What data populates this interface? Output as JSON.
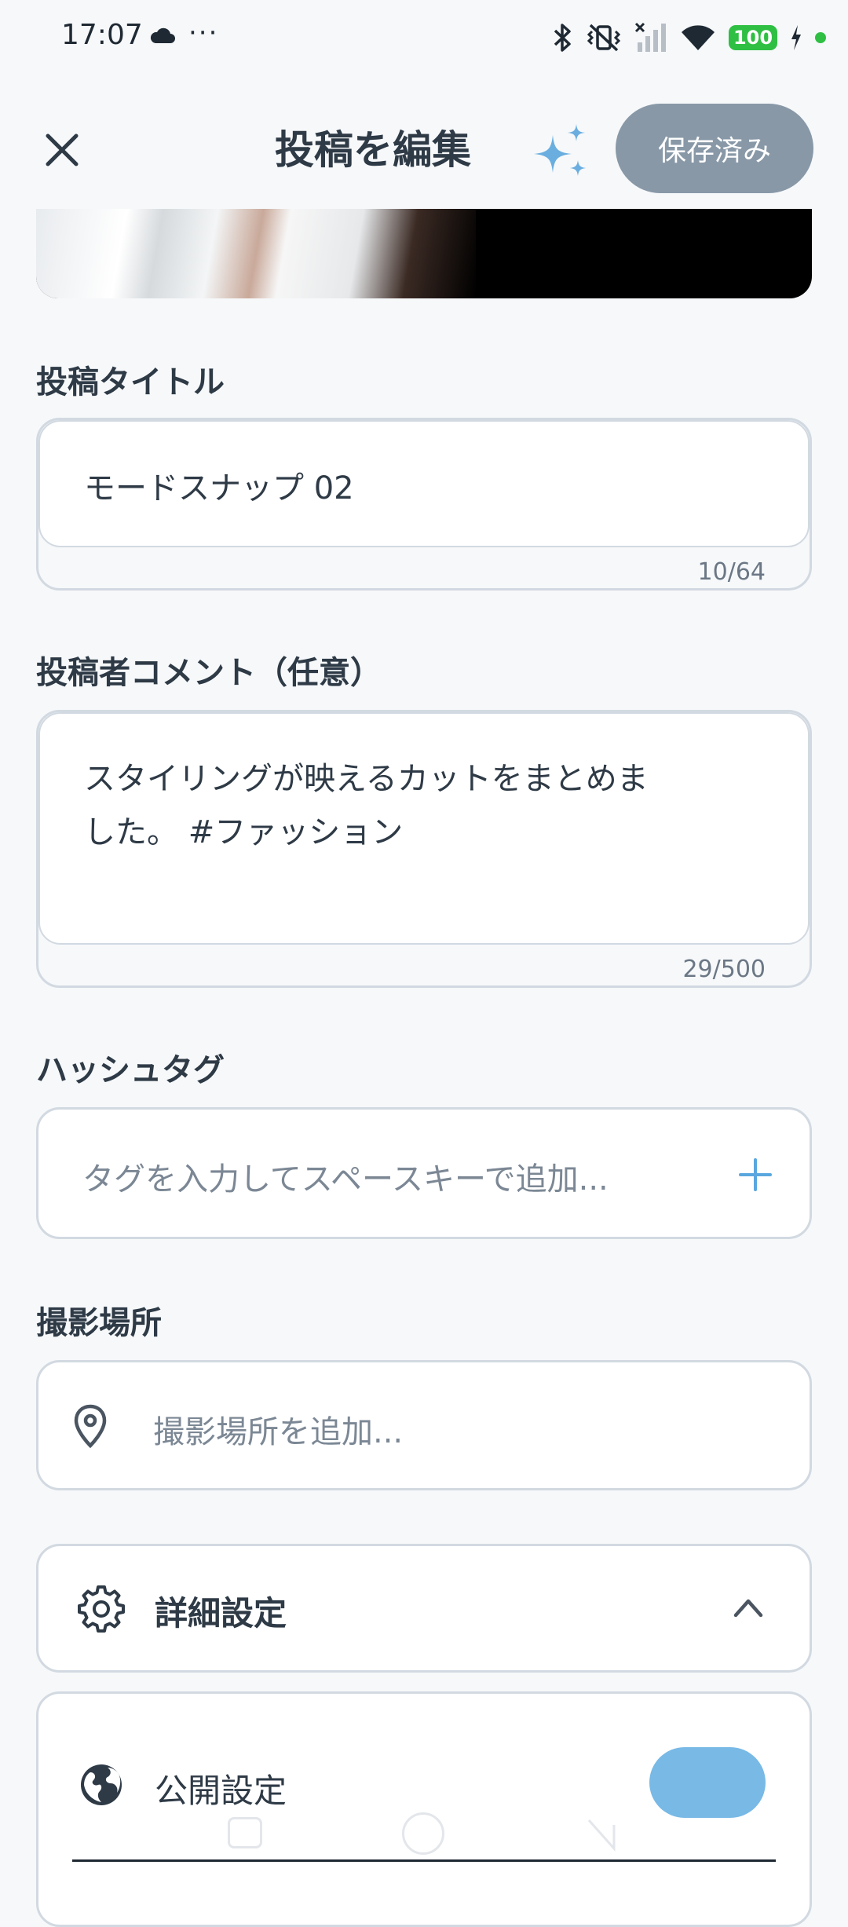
{
  "status_bar": {
    "time": "17:07",
    "dots": "···",
    "battery": "100"
  },
  "header": {
    "title": "投稿を編集",
    "saved_label": "保存済み"
  },
  "title_section": {
    "label": "投稿タイトル",
    "value": "モードスナップ 02",
    "counter": "10/64"
  },
  "comment_section": {
    "label": "投稿者コメント（任意）",
    "line1": "スタイリングが映えるカットをまとめま",
    "line2": "した。 #ファッション",
    "counter": "29/500"
  },
  "hashtag_section": {
    "label": "ハッシュタグ",
    "placeholder": "タグを入力してスペースキーで追加..."
  },
  "location_section": {
    "label": "撮影場所",
    "placeholder": "撮影場所を追加..."
  },
  "advanced": {
    "label": "詳細設定"
  },
  "visibility": {
    "label": "公開設定",
    "toggle_on": true
  }
}
